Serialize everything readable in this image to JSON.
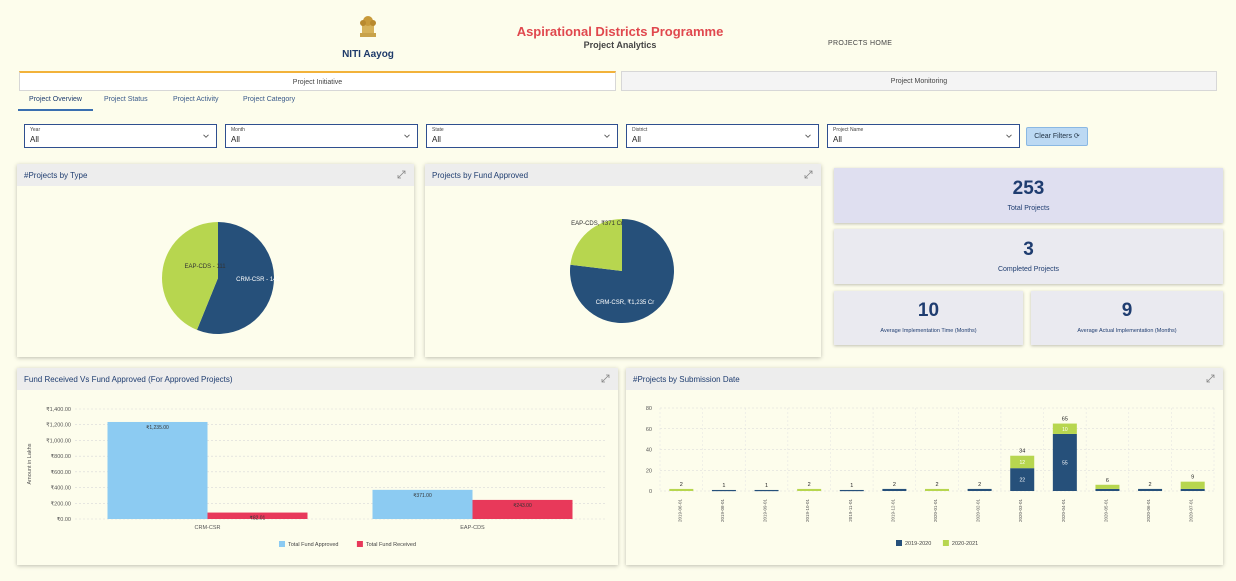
{
  "header": {
    "org_name": "NITI Aayog",
    "title": "Aspirational Districts Programme",
    "subtitle": "Project Analytics",
    "home_link": "PROJECTS HOME"
  },
  "main_tabs": [
    {
      "label": "Project Initiative",
      "active": true
    },
    {
      "label": "Project Monitoring",
      "active": false
    }
  ],
  "sub_tabs": [
    {
      "label": "Project Overview",
      "active": true
    },
    {
      "label": "Project Status",
      "active": false
    },
    {
      "label": "Project Activity",
      "active": false
    },
    {
      "label": "Project Category",
      "active": false
    }
  ],
  "filters": [
    {
      "label": "Year",
      "value": "All"
    },
    {
      "label": "Month",
      "value": "All"
    },
    {
      "label": "State",
      "value": "All"
    },
    {
      "label": "District",
      "value": "All"
    },
    {
      "label": "Project Name",
      "value": "All"
    }
  ],
  "clear_filters_label": "Clear Filters ⟳",
  "kpis": {
    "total_projects": {
      "value": "253",
      "label": "Total Projects"
    },
    "completed_projects": {
      "value": "3",
      "label": "Completed Projects"
    },
    "avg_impl_time": {
      "value": "10",
      "label": "Average Implementation Time (Months)"
    },
    "avg_actual_impl": {
      "value": "9",
      "label": "Average Actual Implementation (Months)"
    }
  },
  "colors": {
    "navy": "#26507a",
    "lime": "#b7d64f",
    "sky": "#8ccbf2",
    "crimson": "#e8395a"
  },
  "chart_data": [
    {
      "type": "pie",
      "title": "#Projects by Type",
      "slices": [
        {
          "label": "CRM-CSR - 142",
          "value": 142,
          "color": "#26507a"
        },
        {
          "label": "EAP-CDS - 111",
          "value": 111,
          "color": "#b7d64f"
        }
      ]
    },
    {
      "type": "pie",
      "title": "Projects by Fund Approved",
      "slices": [
        {
          "label": "CRM-CSR, ₹1,235 Cr",
          "value": 1235,
          "color": "#26507a"
        },
        {
          "label": "EAP-CDS, ₹371 Cr",
          "value": 371,
          "color": "#b7d64f"
        }
      ]
    },
    {
      "type": "bar",
      "title": "Fund Received Vs Fund Approved (For Approved Projects)",
      "ylabel": "Amount in Lakhs",
      "yticks": [
        "₹1,400.00",
        "₹1,200.00",
        "₹1,000.00",
        "₹800.00",
        "₹600.00",
        "₹400.00",
        "₹200.00",
        "₹0.00"
      ],
      "ylim": [
        0,
        1400
      ],
      "categories": [
        "CRM-CSR",
        "EAP-CDS"
      ],
      "series": [
        {
          "name": "Total Fund Approved",
          "color": "#8ccbf2",
          "values": [
            1235.0,
            371.0
          ],
          "labels": [
            "₹1,235.00",
            "₹371.00"
          ]
        },
        {
          "name": "Total Fund Received",
          "color": "#e8395a",
          "values": [
            82.01,
            243.0
          ],
          "labels": [
            "₹82.01",
            "₹243.00"
          ]
        }
      ],
      "legend": "bottom"
    },
    {
      "type": "bar",
      "title": "#Projects by Submission Date",
      "stacked": true,
      "yticks": [
        "80",
        "60",
        "40",
        "20",
        "0"
      ],
      "ylim": [
        0,
        80
      ],
      "categories": [
        "2019-06-01",
        "2019-08-01",
        "2019-09-01",
        "2019-10-01",
        "2019-11-01",
        "2019-12-01",
        "2020-01-01",
        "2020-02-01",
        "2020-03-01",
        "2020-04-01",
        "2020-05-01",
        "2020-06-01",
        "2020-07-01"
      ],
      "series": [
        {
          "name": "2019-2020",
          "color": "#26507a",
          "values": [
            0,
            1,
            1,
            0,
            1,
            2,
            0,
            2,
            22,
            55,
            2,
            2,
            2
          ]
        },
        {
          "name": "2020-2021",
          "color": "#b7d64f",
          "values": [
            2,
            0,
            0,
            2,
            0,
            0,
            2,
            0,
            12,
            10,
            4,
            0,
            7
          ]
        }
      ],
      "totals": [
        2,
        1,
        1,
        2,
        1,
        2,
        2,
        2,
        34,
        65,
        6,
        2,
        9
      ],
      "legend": "bottom"
    }
  ]
}
